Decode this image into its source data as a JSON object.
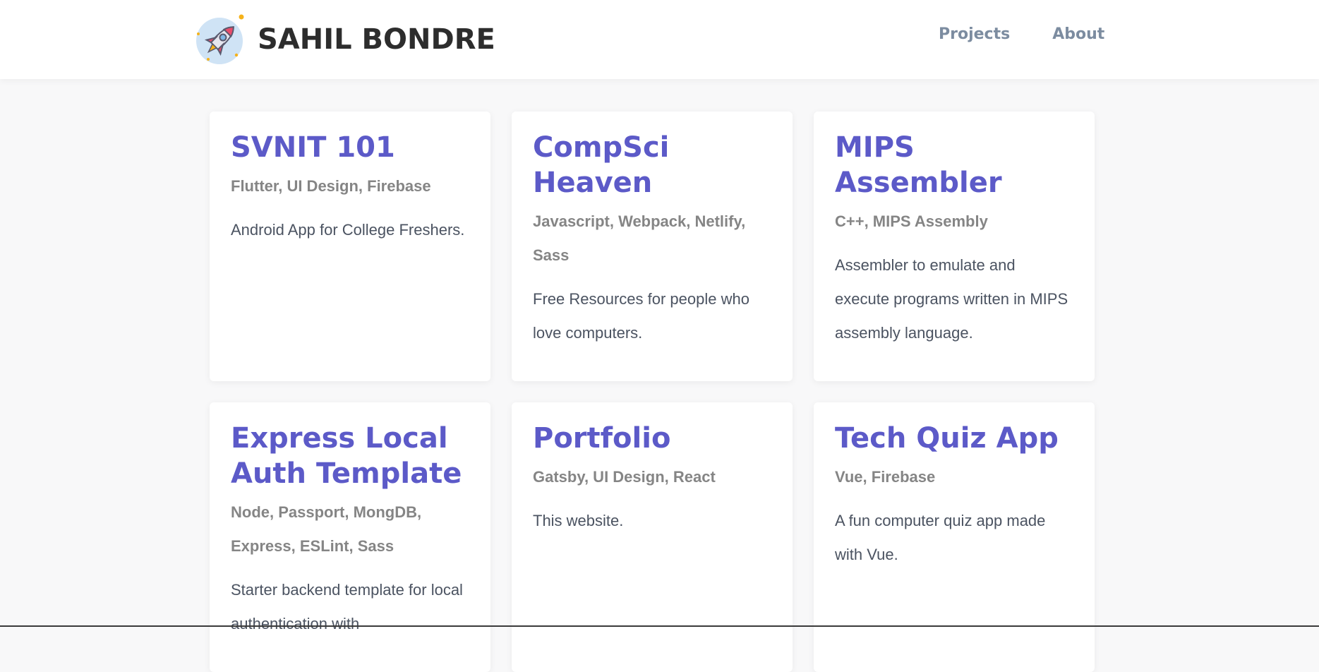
{
  "header": {
    "site_title": "SAHIL BONDRE",
    "logo_icon": "rocket-icon",
    "nav": [
      {
        "label": "Projects"
      },
      {
        "label": "About"
      }
    ]
  },
  "projects": [
    {
      "title": "SVNIT 101",
      "tags": "Flutter, UI Design, Firebase",
      "description": "Android App for College Freshers."
    },
    {
      "title": "CompSci Heaven",
      "tags": "Javascript, Webpack, Netlify, Sass",
      "description": "Free Resources for people who love computers."
    },
    {
      "title": "MIPS Assembler",
      "tags": "C++, MIPS Assembly",
      "description": "Assembler to emulate and execute programs written in MIPS assembly language."
    },
    {
      "title": "Express Local Auth Template",
      "tags": "Node, Passport, MongDB, Express, ESLint, Sass",
      "description": "Starter backend template for local authentication with"
    },
    {
      "title": "Portfolio",
      "tags": "Gatsby, UI Design, React",
      "description": "This website."
    },
    {
      "title": "Tech Quiz App",
      "tags": "Vue, Firebase",
      "description": "A fun computer quiz app made with Vue."
    }
  ],
  "colors": {
    "accent": "#5c5ac8",
    "tags": "#858585",
    "text": "#4b5361",
    "nav": "#7c8ca0"
  }
}
